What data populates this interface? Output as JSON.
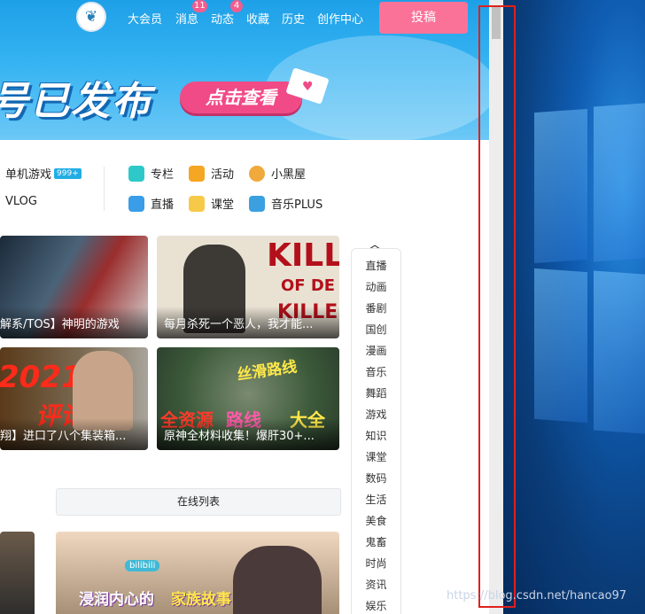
{
  "header": {
    "nav": [
      {
        "label": "大会员"
      },
      {
        "label": "消息",
        "badge": "11"
      },
      {
        "label": "动态",
        "badge": "4"
      },
      {
        "label": "收藏"
      },
      {
        "label": "历史"
      },
      {
        "label": "创作中心"
      }
    ],
    "post_button": "投稿"
  },
  "banner": {
    "title": "号已发布",
    "button": "点击查看"
  },
  "categories": {
    "single_game": "单机游戏",
    "single_game_badge": "999+",
    "vlog": "VLOG",
    "items": [
      "专栏",
      "活动",
      "小黑屋",
      "直播",
      "课堂",
      "音乐PLUS"
    ]
  },
  "cards": [
    {
      "title": "解系/TOS】神明的游戏"
    },
    {
      "title": "每月杀死一个恶人，我才能..."
    },
    {
      "title": "翔】进口了八个集装箱..."
    },
    {
      "title": "原神全材料收集！爆肝30+..."
    }
  ],
  "card_art": {
    "kill": "KILL",
    "of_de": "OF DE",
    "killed": "KILLED",
    "year": "2021",
    "review": "评论",
    "silk_road": "丝滑路线",
    "resources": "全资源",
    "route": "路线",
    "full": "大全",
    "story": "家族故事",
    "story_prefix": "浸润内心的",
    "logo_badge": "bilibili"
  },
  "sidebar": [
    "直播",
    "动画",
    "番剧",
    "国创",
    "漫画",
    "音乐",
    "舞蹈",
    "游戏",
    "知识",
    "课堂",
    "数码",
    "生活",
    "美食",
    "鬼畜",
    "时尚",
    "资讯",
    "娱乐"
  ],
  "online_list": "在线列表",
  "watermark": "https://blog.csdn.net/hancao97",
  "colors": {
    "accent_pink": "#fb7299",
    "banner_blue": "#1ea0e8",
    "highlight_red": "#e0201c"
  }
}
